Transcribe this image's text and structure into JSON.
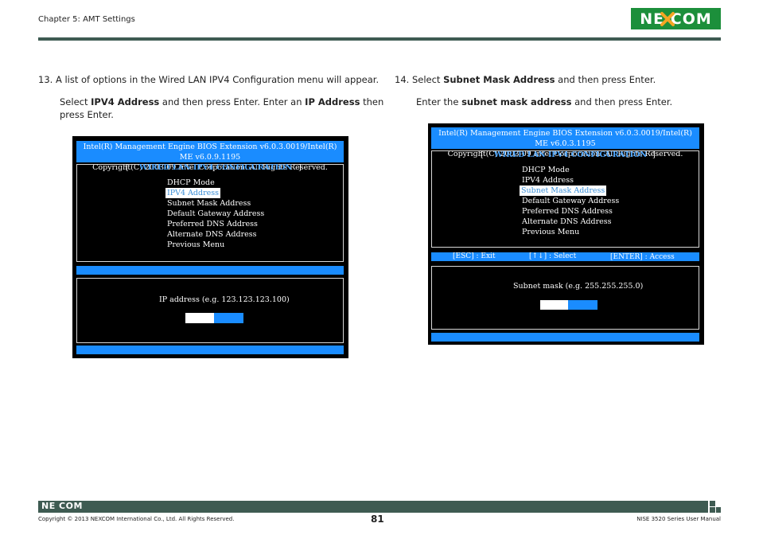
{
  "header": {
    "chapter": "Chapter 5: AMT Settings",
    "logo": "NE COM"
  },
  "step13": {
    "line1": "13.   A list of options in the Wired LAN IPV4 Configuration menu will appear.",
    "l2_a": "Select ",
    "l2_b": "IPV4 Address",
    "l2_c": " and then press Enter. Enter an ",
    "l2_d": "IP Address",
    "l2_e": " then",
    "line3": "press Enter."
  },
  "step14": {
    "l1_a": "14.   Select ",
    "l1_b": "Subnet Mask Address",
    "l1_c": " and then press Enter.",
    "l2_a": "Enter the ",
    "l2_b": "subnet mask address",
    "l2_c": " and then press Enter."
  },
  "bios_left": {
    "header_line1": "Intel(R) Management Engine BIOS Extension v6.0.3.0019/Intel(R) ME v6.0.9.1195",
    "header_line2": "Copyright(C) 2003-09 Intel Corporation. All Rights Reserved.",
    "bracket_open": "[",
    "bracket_close": "]",
    "menu_title": "WIRED LAN IPV4 CONFIGURATION",
    "items": [
      "DHCP Mode",
      "IPV4 Address",
      "Subnet Mask Address",
      "Default Gateway Address",
      "Preferred DNS Address",
      "Alternate DNS Address",
      "Previous Menu"
    ],
    "prompt": "IP address (e.g. 123.123.123.100)"
  },
  "bios_right": {
    "header_line1": "Intel(R) Management Engine BIOS Extension v6.0.3.0019/Intel(R) ME v6.0.3.1195",
    "header_line2": "Copyright(C) 2003-09 Intel Corporation. All Rights Reserved.",
    "bracket_open": "[",
    "bracket_close": "]",
    "menu_title": "WIRED LAN IPV4 CONFIGURATION",
    "items": [
      "DHCP Mode",
      "IPV4 Address",
      "Subnet Mask Address",
      "Default Gateway Address",
      "Preferred DNS Address",
      "Alternate DNS Address",
      "Previous Menu"
    ],
    "help_esc": "[ESC] : Exit",
    "help_select": "[↑↓] : Select",
    "help_enter": "[ENTER] : Access",
    "prompt": "Subnet mask (e.g. 255.255.255.0)"
  },
  "footer": {
    "logo": "NE COM",
    "copyright": "Copyright © 2013 NEXCOM International Co., Ltd. All Rights Reserved.",
    "page": "81",
    "manual": "NISE 3520 Series User Manual"
  },
  "colors": {
    "brand_green": "#1c8f3b",
    "rule": "#3e5b52",
    "bios_blue": "#1a8cff"
  }
}
